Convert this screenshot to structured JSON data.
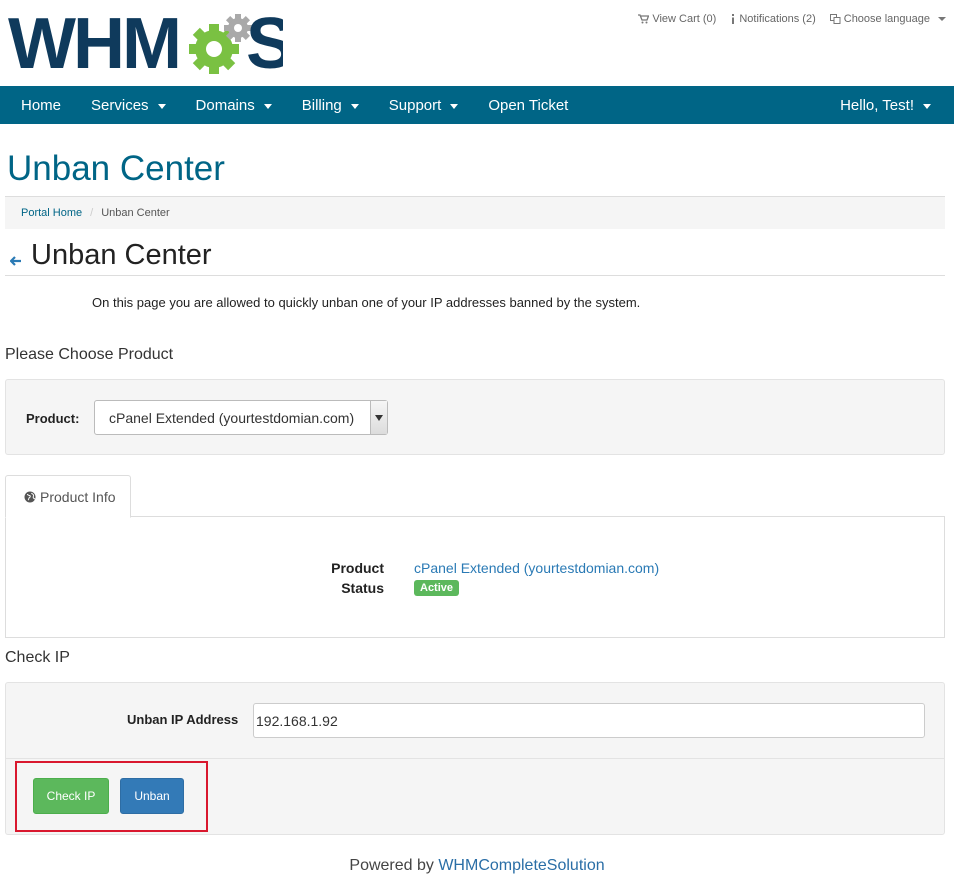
{
  "brand": {
    "logo_text_left": "WHM",
    "logo_text_right": "S",
    "colors": {
      "navy": "#0f3a5c",
      "green": "#7ac142",
      "gray": "#999999",
      "nav": "#006586"
    }
  },
  "top_links": {
    "cart": "View Cart (0)",
    "notifications": "Notifications (2)",
    "language": "Choose language"
  },
  "nav": {
    "items": [
      "Home",
      "Services",
      "Domains",
      "Billing",
      "Support",
      "Open Ticket"
    ],
    "user": "Hello, Test!"
  },
  "page": {
    "title": "Unban Center",
    "breadcrumb": {
      "home": "Portal Home",
      "current": "Unban Center"
    },
    "subtitle": "Unban Center",
    "intro": "On this page you are allowed to quickly unban one of your IP addresses banned by the system."
  },
  "product_section": {
    "heading": "Please Choose Product",
    "label": "Product:",
    "selected": "cPanel Extended (yourtestdomian.com)"
  },
  "tabs": {
    "product_info": "Product Info"
  },
  "product_info": {
    "product_label": "Product",
    "status_label": "Status",
    "product_value": "cPanel Extended (yourtestdomian.com)",
    "status_value": "Active"
  },
  "check_ip": {
    "heading": "Check IP",
    "label": "Unban IP Address",
    "value": "192.168.1.92",
    "check_button": "Check IP",
    "unban_button": "Unban"
  },
  "footer": {
    "prefix": "Powered by ",
    "link": "WHMCompleteSolution"
  }
}
